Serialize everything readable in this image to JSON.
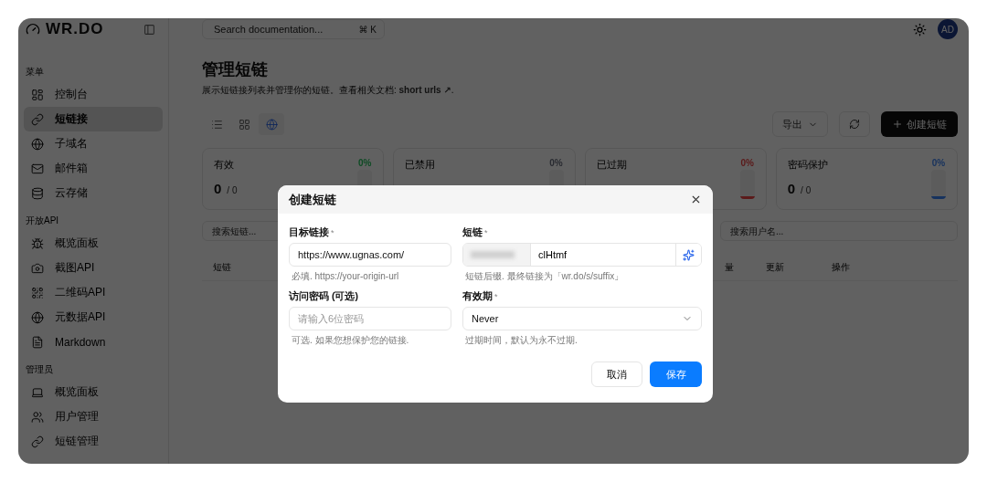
{
  "brand": {
    "name": "WR.DO"
  },
  "search": {
    "placeholder": "Search documentation...",
    "shortcut": "⌘ K"
  },
  "user": {
    "initials": "AD"
  },
  "sidebar": {
    "sections": [
      {
        "title": "菜单",
        "items": [
          {
            "label": "控制台",
            "selected": false
          },
          {
            "label": "短链接",
            "selected": true
          },
          {
            "label": "子域名",
            "selected": false
          },
          {
            "label": "邮件箱",
            "selected": false
          },
          {
            "label": "云存储",
            "selected": false
          }
        ]
      },
      {
        "title": "开放API",
        "items": [
          {
            "label": "概览面板",
            "selected": false
          },
          {
            "label": "截图API",
            "selected": false
          },
          {
            "label": "二维码API",
            "selected": false
          },
          {
            "label": "元数据API",
            "selected": false
          },
          {
            "label": "Markdown",
            "selected": false
          }
        ]
      },
      {
        "title": "管理员",
        "items": [
          {
            "label": "概览面板",
            "selected": false
          },
          {
            "label": "用户管理",
            "selected": false
          },
          {
            "label": "短链管理",
            "selected": false
          }
        ]
      }
    ]
  },
  "page": {
    "title": "管理短链",
    "subtitle": "展示短链接列表并管理你的短链。查看相关文档: ",
    "doc_link": "short urls ↗",
    "subtitle_end": "."
  },
  "toolbar": {
    "views": [
      {
        "selected": false
      },
      {
        "selected": false
      },
      {
        "selected": true
      }
    ],
    "export": "导出",
    "create": "创建短链"
  },
  "stats": [
    {
      "label": "有效",
      "value": "0",
      "total": "/ 0",
      "percent": "0%",
      "color": "#0d4b24"
    },
    {
      "label": "已禁用",
      "percent": "0%",
      "color": "#292b31"
    },
    {
      "label": "已过期",
      "percent": "0%",
      "color": "#5b1a1a"
    },
    {
      "label": "密码保护",
      "value": "0",
      "total": "/ 0",
      "percent": "0%",
      "color": "#16325e"
    }
  ],
  "filters": [
    {
      "placeholder": "搜索短链..."
    },
    {
      "placeholder": "搜索用户名..."
    }
  ],
  "table": {
    "columns": [
      "短链",
      "量",
      "更新",
      "操作"
    ]
  },
  "dialog": {
    "title": "创建短链",
    "fields": [
      {
        "kind": "text",
        "label": "目标链接",
        "mark": "*",
        "value": "https://www.ugnas.com/",
        "hint": "必填. https://your-origin-url"
      },
      {
        "kind": "slug",
        "label": "短链",
        "mark": "*",
        "value": "clHtmf",
        "hint": "短链后缀. 最终链接为「wr.do/s/suffix」"
      },
      {
        "kind": "text",
        "label": "访问密码 (可选)",
        "placeholder": "请输入6位密码",
        "hint": "可选. 如果您想保护您的链接."
      },
      {
        "kind": "select",
        "label": "有效期",
        "mark": "*",
        "value": "Never",
        "hint": "过期时间，默认为永不过期."
      }
    ],
    "cancel": "取消",
    "save": "保存"
  }
}
